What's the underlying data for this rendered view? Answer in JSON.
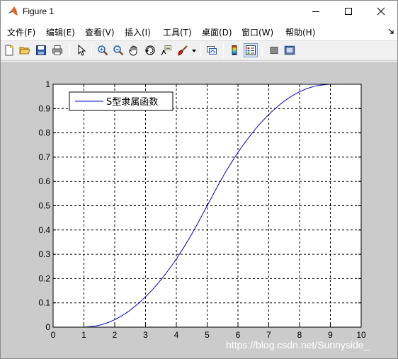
{
  "window": {
    "title": "Figure 1",
    "minimize_icon": "minimize-icon",
    "maximize_icon": "maximize-icon",
    "close_icon": "close-icon"
  },
  "menu": {
    "items": [
      "文件(F)",
      "编辑(E)",
      "查看(V)",
      "插入(I)",
      "工具(T)",
      "桌面(D)",
      "窗口(W)",
      "帮助(H)"
    ],
    "overflow_icon": "dock-arrow-icon"
  },
  "toolbar": {
    "icons": [
      "new-figure-icon",
      "open-file-icon",
      "save-icon",
      "print-icon",
      "edit-plot-arrow-icon",
      "zoom-in-icon",
      "zoom-out-icon",
      "pan-hand-icon",
      "rotate-3d-icon",
      "data-cursor-icon",
      "brush-icon",
      "link-plot-icon",
      "colorbar-icon",
      "legend-icon",
      "hide-plot-tools-icon",
      "show-plot-tools-icon"
    ]
  },
  "colors": {
    "figure_background": "#cbcbcb",
    "axes_background": "#ffffff",
    "line": "#0000cc",
    "grid": "#000000"
  },
  "chart_data": {
    "type": "line",
    "title": "",
    "xlabel": "",
    "ylabel": "",
    "xlim": [
      0,
      10
    ],
    "ylim": [
      0,
      1
    ],
    "xticks": [
      0,
      1,
      2,
      3,
      4,
      5,
      6,
      7,
      8,
      9,
      10
    ],
    "yticks": [
      0,
      0.1,
      0.2,
      0.3,
      0.4,
      0.5,
      0.6,
      0.7,
      0.8,
      0.9,
      1
    ],
    "xtick_labels": [
      "0",
      "1",
      "2",
      "3",
      "4",
      "5",
      "6",
      "7",
      "8",
      "9",
      "10"
    ],
    "ytick_labels": [
      "0",
      "0.1",
      "0.2",
      "0.3",
      "0.4",
      "0.5",
      "0.6",
      "0.7",
      "0.8",
      "0.9",
      "1"
    ],
    "grid": true,
    "legend_position": "top-left",
    "series": [
      {
        "name": "S型隶属函数",
        "x": [
          0,
          0.5,
          1,
          1.5,
          2,
          2.5,
          3,
          3.5,
          4,
          4.5,
          5,
          5.5,
          6,
          6.5,
          7,
          7.5,
          8,
          8.5,
          9,
          9.5,
          10
        ],
        "y": [
          0,
          0,
          0,
          0.008,
          0.031,
          0.07,
          0.125,
          0.195,
          0.281,
          0.383,
          0.5,
          0.617,
          0.719,
          0.805,
          0.875,
          0.93,
          0.969,
          0.992,
          1,
          1,
          1
        ]
      }
    ]
  },
  "watermark": "https://blog.csdn.net/Sunnyside_"
}
